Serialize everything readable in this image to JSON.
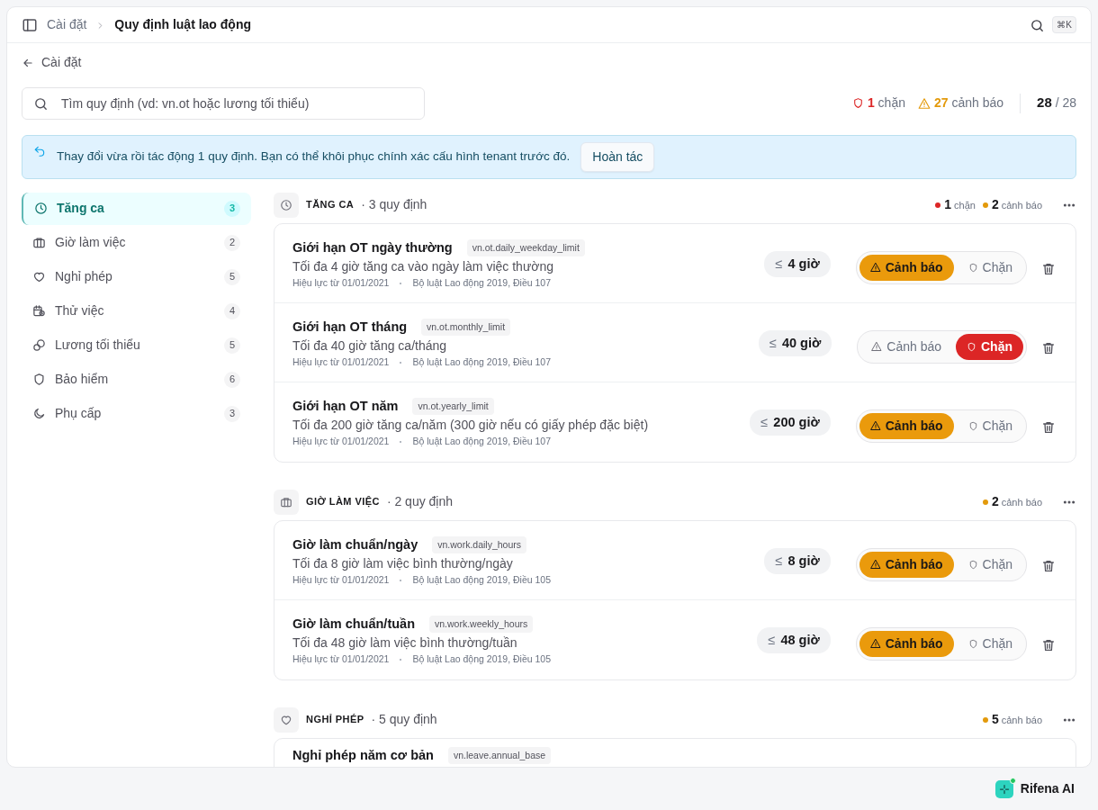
{
  "breadcrumb": {
    "parent": "Cài đặt",
    "current": "Quy định luật lao động"
  },
  "search_shortcut": "⌘K",
  "back_link": "Cài đặt",
  "search": {
    "placeholder": "Tìm quy định (vd: vn.ot hoặc lương tối thiểu)"
  },
  "stats": [
    {
      "kind": "block",
      "count": "1",
      "label": "chặn"
    },
    {
      "kind": "warn",
      "count": "27",
      "label": "cảnh báo"
    }
  ],
  "total": {
    "shown": "28",
    "all": "/ 28"
  },
  "notice": {
    "text": "Thay đổi vừa rồi tác động 1 quy định. Bạn có thể khôi phục chính xác cấu hình tenant trước đó.",
    "button": "Hoàn tác"
  },
  "sidebar": {
    "items": [
      {
        "label": "Tăng ca",
        "count": "3",
        "selected": true
      },
      {
        "label": "Giờ làm việc",
        "count": "2",
        "selected": false
      },
      {
        "label": "Nghỉ phép",
        "count": "5",
        "selected": false
      },
      {
        "label": "Thử việc",
        "count": "4",
        "selected": false
      },
      {
        "label": "Lương tối thiểu",
        "count": "5",
        "selected": false
      },
      {
        "label": "Bảo hiểm",
        "count": "6",
        "selected": false
      },
      {
        "label": "Phụ cấp",
        "count": "3",
        "selected": false
      }
    ]
  },
  "sections": [
    {
      "title": "TĂNG CA",
      "count": "· 3 quy định",
      "summary": [
        {
          "kind": "block",
          "count": "1",
          "label": "chặn"
        },
        {
          "kind": "warn",
          "count": "2",
          "label": "cảnh báo"
        }
      ],
      "rules": [
        {
          "title": "Giới hạn OT ngày thường",
          "code": "vn.ot.daily_weekday_limit",
          "description": "Tối đa 4 giờ tăng ca vào ngày làm việc thường",
          "effective": "Hiệu lực từ 01/01/2021",
          "source": "Bộ luật Lao động 2019, Điều 107",
          "op": "≤",
          "value": "4 giờ",
          "options": [
            {
              "kind": "warn",
              "label": "Cảnh báo",
              "selected": true
            },
            {
              "kind": "block",
              "label": "Chặn",
              "selected": false
            }
          ]
        },
        {
          "title": "Giới hạn OT tháng",
          "code": "vn.ot.monthly_limit",
          "description": "Tối đa 40 giờ tăng ca/tháng",
          "effective": "Hiệu lực từ 01/01/2021",
          "source": "Bộ luật Lao động 2019, Điều 107",
          "op": "≤",
          "value": "40 giờ",
          "options": [
            {
              "kind": "warn",
              "label": "Cảnh báo",
              "selected": false
            },
            {
              "kind": "block",
              "label": "Chặn",
              "selected": true
            }
          ]
        },
        {
          "title": "Giới hạn OT năm",
          "code": "vn.ot.yearly_limit",
          "description": "Tối đa 200 giờ tăng ca/năm (300 giờ nếu có giấy phép đặc biệt)",
          "effective": "Hiệu lực từ 01/01/2021",
          "source": "Bộ luật Lao động 2019, Điều 107",
          "op": "≤",
          "value": "200 giờ",
          "options": [
            {
              "kind": "warn",
              "label": "Cảnh báo",
              "selected": true
            },
            {
              "kind": "block",
              "label": "Chặn",
              "selected": false
            }
          ]
        }
      ]
    },
    {
      "title": "GIỜ LÀM VIỆC",
      "count": "· 2 quy định",
      "summary": [
        {
          "kind": "warn",
          "count": "2",
          "label": "cảnh báo"
        }
      ],
      "rules": [
        {
          "title": "Giờ làm chuẩn/ngày",
          "code": "vn.work.daily_hours",
          "description": "Tối đa 8 giờ làm việc bình thường/ngày",
          "effective": "Hiệu lực từ 01/01/2021",
          "source": "Bộ luật Lao động 2019, Điều 105",
          "op": "≤",
          "value": "8 giờ",
          "options": [
            {
              "kind": "warn",
              "label": "Cảnh báo",
              "selected": true
            },
            {
              "kind": "block",
              "label": "Chặn",
              "selected": false
            }
          ]
        },
        {
          "title": "Giờ làm chuẩn/tuần",
          "code": "vn.work.weekly_hours",
          "description": "Tối đa 48 giờ làm việc bình thường/tuần",
          "effective": "Hiệu lực từ 01/01/2021",
          "source": "Bộ luật Lao động 2019, Điều 105",
          "op": "≤",
          "value": "48 giờ",
          "options": [
            {
              "kind": "warn",
              "label": "Cảnh báo",
              "selected": true
            },
            {
              "kind": "block",
              "label": "Chặn",
              "selected": false
            }
          ]
        }
      ]
    },
    {
      "title": "NGHỈ PHÉP",
      "count": "· 5 quy định",
      "summary": [
        {
          "kind": "warn",
          "count": "5",
          "label": "cảnh báo"
        }
      ],
      "rules": [
        {
          "title": "Nghỉ phép năm cơ bản",
          "code": "vn.leave.annual_base"
        }
      ]
    }
  ],
  "assistant": {
    "label": "Rifena AI"
  }
}
